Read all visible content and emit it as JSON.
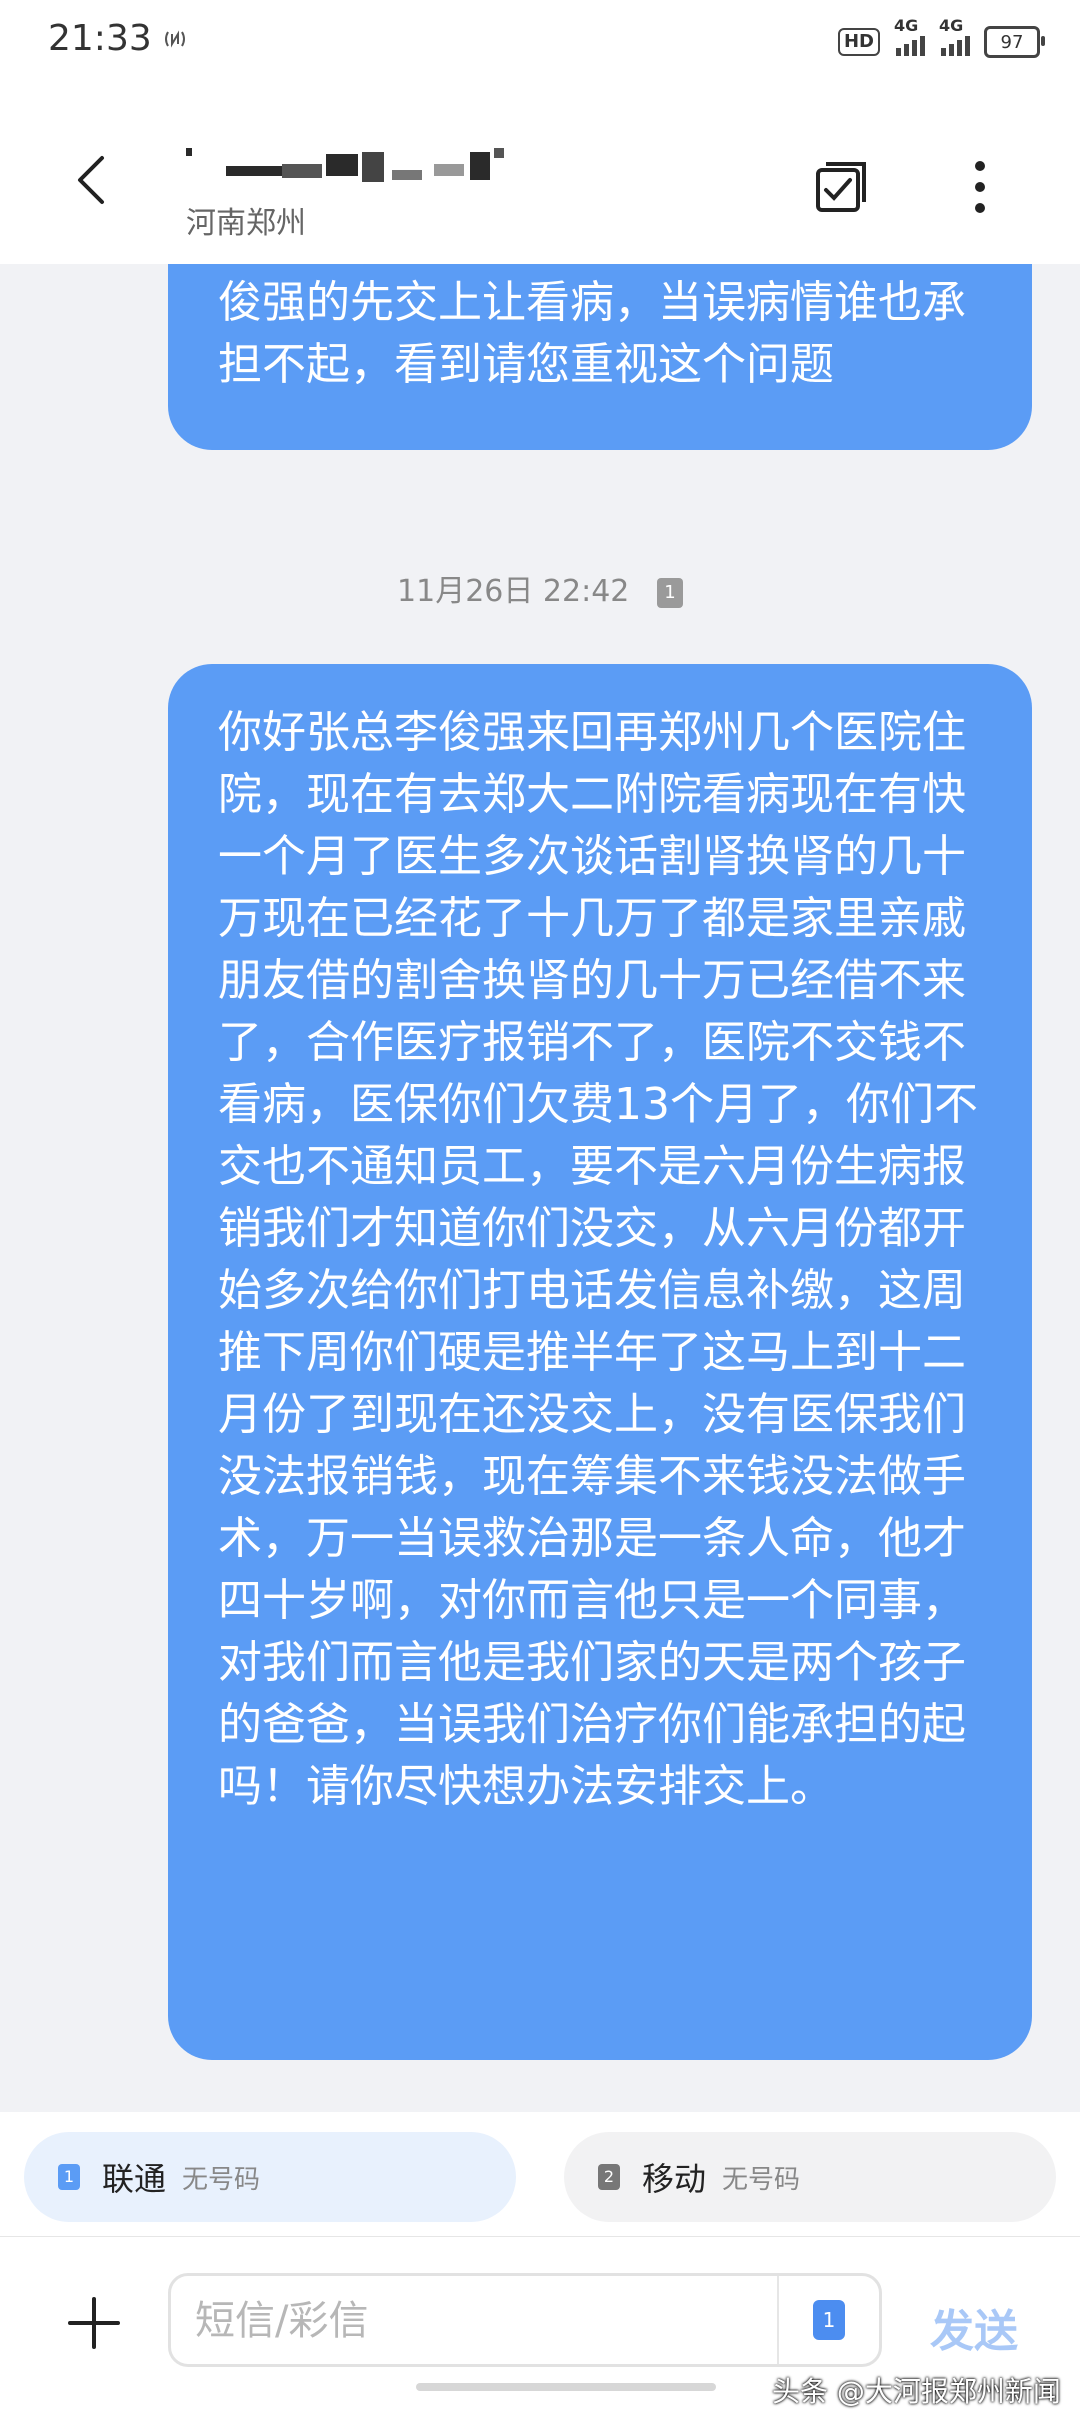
{
  "status_bar": {
    "time": "21:33",
    "hd_label": "HD",
    "hd_sub": "1 2",
    "network_1": "4G",
    "network_2": "4G",
    "battery": "97"
  },
  "header": {
    "location": "河南郑州",
    "back_icon": "back-arrow-icon",
    "multiselect_icon": "checkbox-icon",
    "more_icon": "more-vertical-icon"
  },
  "conversation": {
    "messages": [
      {
        "text": "问了现在可以网上缴费，能不能先把李俊强的先交上让看病，当误病情谁也承担不起，看到请您重视这个问题"
      },
      {
        "timestamp": "11月26日 22:42",
        "sim": "1",
        "text": "你好张总李俊强来回再郑州几个医院住院，现在有去郑大二附院看病现在有快一个月了医生多次谈话割肾换肾的几十万现在已经花了十几万了都是家里亲戚朋友借的割舍换肾的几十万已经借不来了，合作医疗报销不了，医院不交钱不看病，医保你们欠费13个月了，你们不交也不通知员工，要不是六月份生病报销我们才知道你们没交，从六月份都开始多次给你们打电话发信息补缴，这周推下周你们硬是推半年了这马上到十二月份了到现在还没交上，没有医保我们没法报销钱，现在筹集不来钱没法做手术，万一当误救治那是一条人命，他才四十岁啊，对你而言他只是一个同事，对我们而言他是我们家的天是两个孩子的爸爸，当误我们治疗你们能承担的起吗！请你尽快想办法安排交上。"
      }
    ]
  },
  "sim_selector": {
    "sim1": {
      "num": "1",
      "carrier": "联通",
      "status": "无号码"
    },
    "sim2": {
      "num": "2",
      "carrier": "移动",
      "status": "无号码"
    }
  },
  "compose": {
    "placeholder": "短信/彩信",
    "sim_num": "1",
    "send_label": "发送"
  },
  "watermark": "头条 @大河报郑州新闻",
  "colors": {
    "bubble": "#5b9cf5",
    "chat_bg": "#f1f2f5",
    "send_disabled": "#a9c8f7"
  }
}
